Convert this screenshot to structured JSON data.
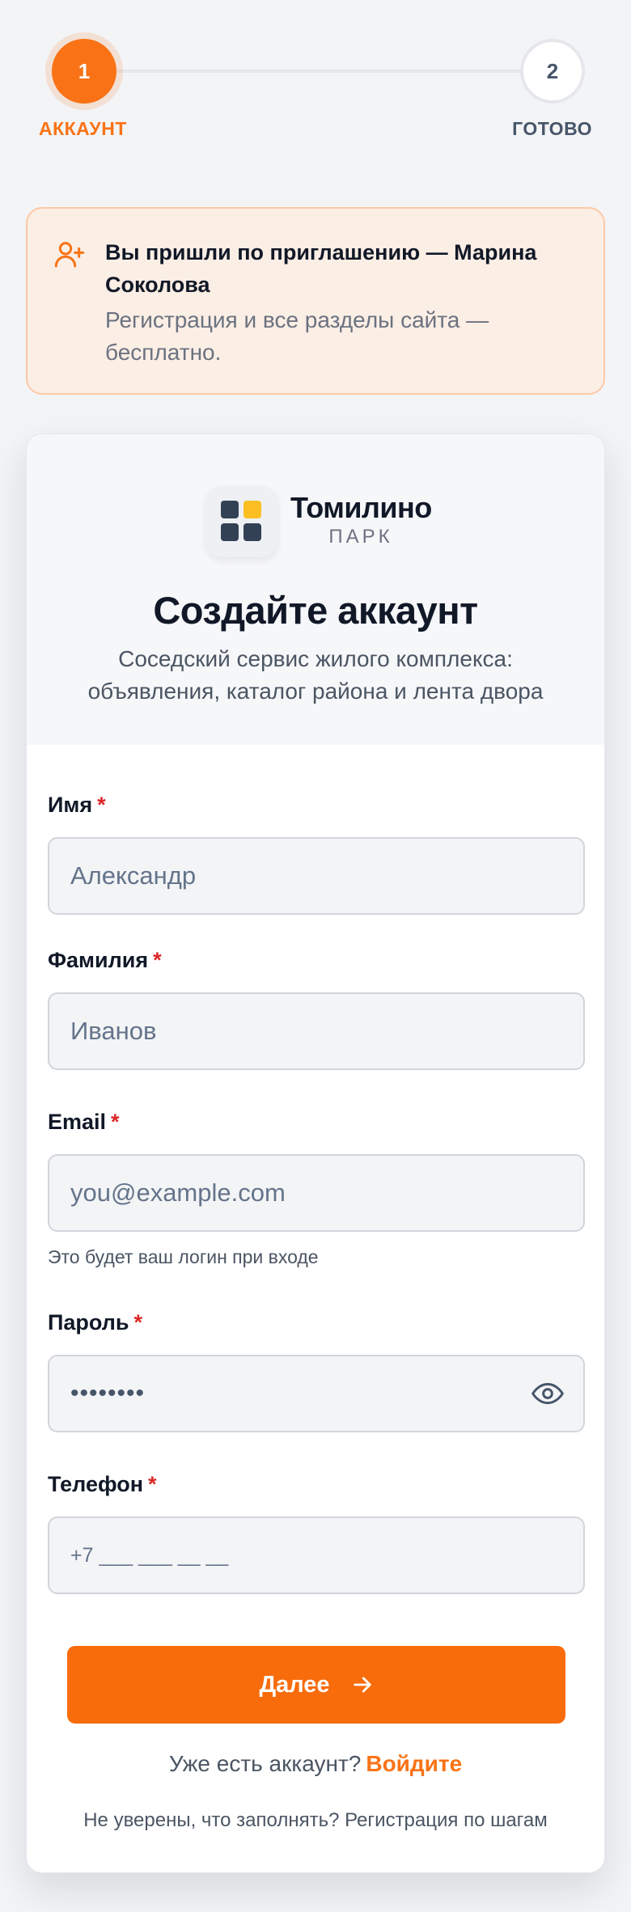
{
  "stepper": {
    "step1": {
      "number": "1",
      "label": "АККАУНТ"
    },
    "step2": {
      "number": "2",
      "label": "ГОТОВО"
    }
  },
  "invite": {
    "title": "Вы пришли по приглашению — Марина Соколова",
    "subtitle": "Регистрация и все разделы сайта — бесплатно.",
    "icon": "user-plus-icon"
  },
  "brand": {
    "name": "Томилино",
    "sub": "ПАРК"
  },
  "form": {
    "title": "Создайте аккаунт",
    "description": "Соседский сервис жилого комплекса: объявления, каталог района и лента двора",
    "required_mark": "*",
    "first_name": {
      "label": "Имя",
      "placeholder": "Александр"
    },
    "last_name": {
      "label": "Фамилия",
      "placeholder": "Иванов"
    },
    "email": {
      "label": "Email",
      "placeholder": "you@example.com",
      "hint": "Это будет ваш логин при входе"
    },
    "password": {
      "label": "Пароль",
      "value": "••••••••"
    },
    "phone": {
      "label": "Телефон",
      "placeholder": "+7 ___ ___ __ __"
    },
    "next_button": "Далее",
    "login_prompt": "Уже есть аккаунт?",
    "login_link": "Войдите",
    "steps_link": "Не уверены, что заполнять? Регистрация по шагам"
  },
  "colors": {
    "accent": "#f97316",
    "required": "#dc2626",
    "banner_bg": "#fbeee5",
    "logo_yellow": "#fbbf24",
    "logo_dark": "#334155"
  }
}
